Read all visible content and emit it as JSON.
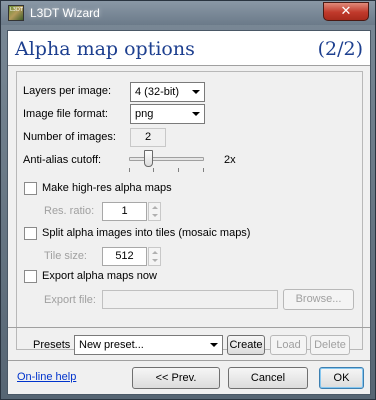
{
  "window": {
    "title": "L3DT Wizard",
    "icon_label": "L3DT",
    "close_symbol": "✕"
  },
  "header": {
    "title": "Alpha map options",
    "step": "(2/2)"
  },
  "layers_per_image": {
    "label": "Layers per image:",
    "value": "4 (32-bit)"
  },
  "image_file_format": {
    "label": "Image file format:",
    "value": "png"
  },
  "number_of_images": {
    "label": "Number of images:",
    "value": "2"
  },
  "anti_alias": {
    "label": "Anti-alias cutoff:",
    "value": "2x",
    "level": 0.25
  },
  "high_res": {
    "label": "Make high-res alpha maps",
    "checked": false,
    "ratio_label": "Res. ratio:",
    "ratio_value": "1"
  },
  "split_tiles": {
    "label": "Split alpha images into tiles (mosaic maps)",
    "checked": false,
    "tile_label": "Tile size:",
    "tile_value": "512"
  },
  "export_now": {
    "label": "Export alpha maps now",
    "checked": false,
    "file_label": "Export file:",
    "file_value": "",
    "browse_label": "Browse..."
  },
  "presets": {
    "label": "Presets",
    "value": "New preset...",
    "create_label": "Create",
    "load_label": "Load",
    "delete_label": "Delete"
  },
  "footer": {
    "help_link": "On-line help",
    "prev_label": "<< Prev.",
    "cancel_label": "Cancel",
    "ok_label": "OK"
  }
}
